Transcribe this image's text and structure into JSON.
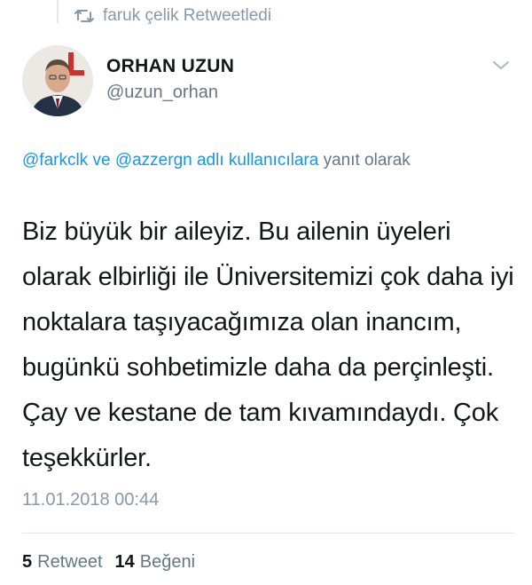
{
  "retweet_context": {
    "icon": "retweet-icon",
    "text": "faruk çelik Retweetledi"
  },
  "author": {
    "avatar_icon": "profile-photo",
    "display_name": "ORHAN UZUN",
    "handle": "@uzun_orhan"
  },
  "menu_icon": "chevron-down-icon",
  "reply_context": {
    "mention_1": "@farkclk",
    "connector": "ve",
    "mention_2": "@azzergn adlı kullanıcılara",
    "suffix": "yanıt olarak"
  },
  "tweet": {
    "text": "Biz büyük bir aileyiz. Bu ailenin üyeleri olarak elbirliği ile Üniversitemizi çok daha iyi noktalara taşıyacağımıza olan inancım, bugünkü sohbetimizle daha da perçinleşti. Çay ve kestane de tam kıvamındaydı. Çok teşekkürler.",
    "timestamp": "11.01.2018 00:44"
  },
  "stats": {
    "retweet_count": "5",
    "retweet_label": "Retweet",
    "like_count": "14",
    "like_label": "Beğeni"
  },
  "colors": {
    "text_primary": "#14171a",
    "text_secondary": "#657786",
    "muted": "#8899a6",
    "link": "#1b95e0",
    "border": "#e1e8ed"
  }
}
